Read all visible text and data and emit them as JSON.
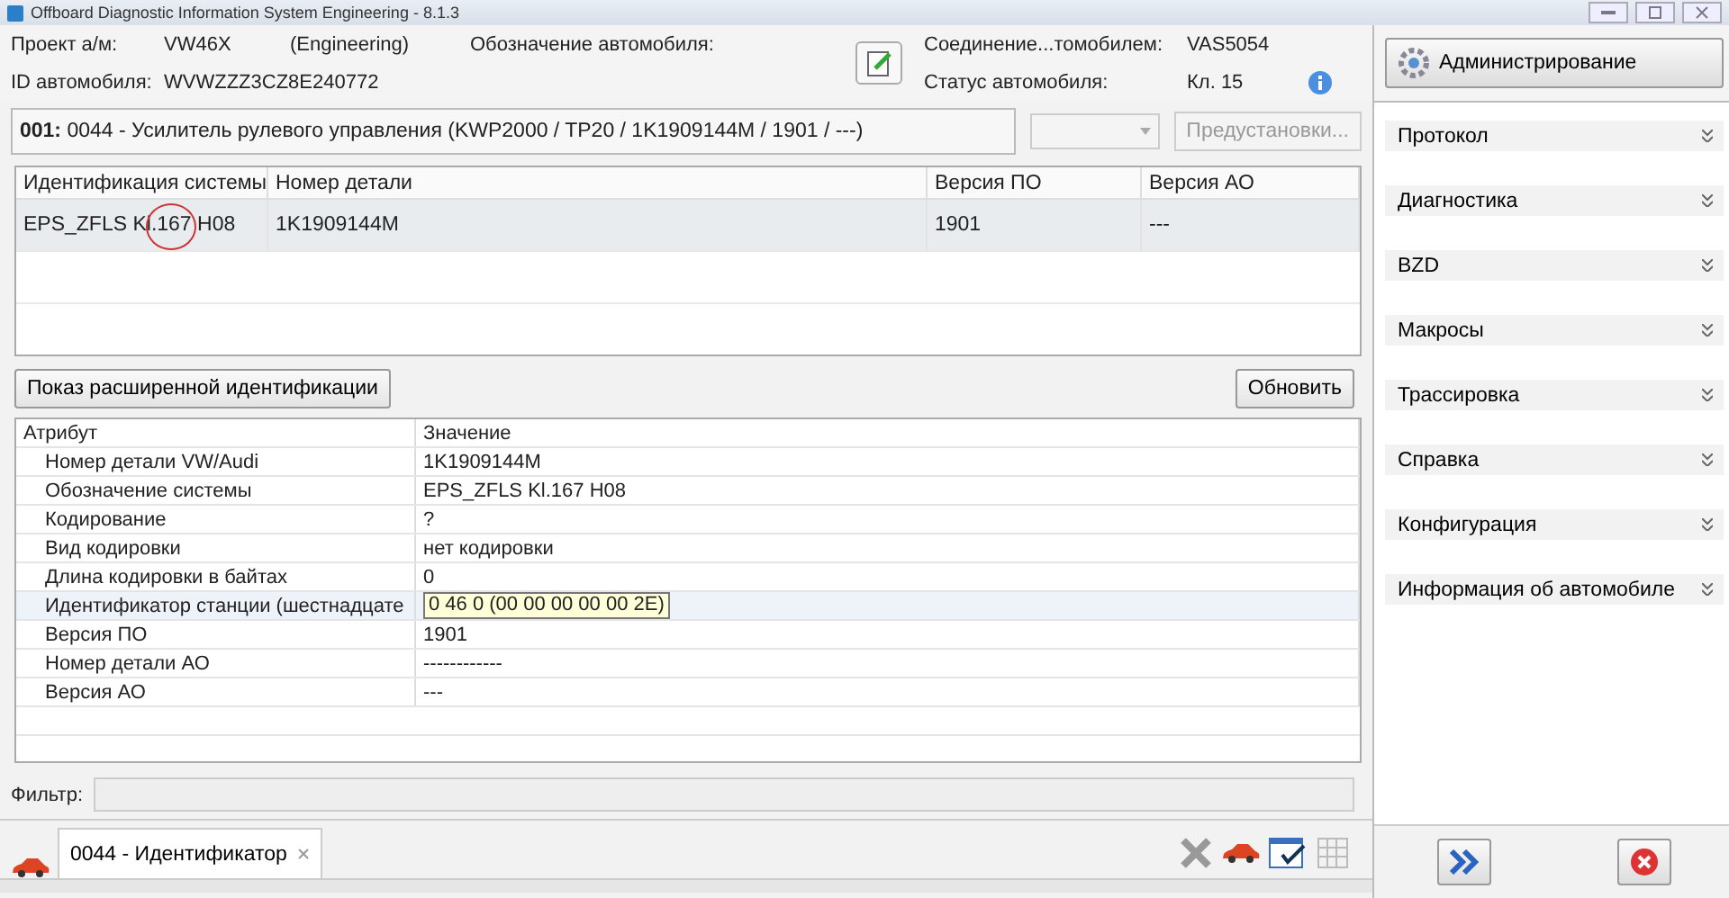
{
  "window": {
    "title": "Offboard Diagnostic Information System Engineering - 8.1.3"
  },
  "header": {
    "project_label": "Проект а/м:",
    "project": "VW46X",
    "project_mode": "(Engineering)",
    "designation_label": "Обозначение автомобиля:",
    "vin_label": "ID автомобиля:",
    "vin": "WVWZZZ3CZ8E240772",
    "connection_label": "Соединение...томобилем:",
    "connection": "VAS5054",
    "status_label": "Статус автомобиля:",
    "status": "Кл. 15"
  },
  "module": {
    "number": "001:",
    "text": "0044 - Усилитель рулевого управления  (KWP2000 / TP20 / 1K1909144M / 1901 / ---)",
    "preset_button": "Предустановки..."
  },
  "system_table": {
    "columns": [
      "Идентификация системы",
      "Номер детали",
      "Версия ПО",
      "Версия АО"
    ],
    "rows": [
      [
        "EPS_ZFLS Kl.167 H08",
        "1K1909144M",
        "1901",
        "---"
      ]
    ]
  },
  "extended_button": "Показ расширенной идентификации",
  "refresh_button": "Обновить",
  "attributes": {
    "columns": [
      "Атрибут",
      "Значение"
    ],
    "rows": [
      {
        "attribute": "Номер детали VW/Audi",
        "value": "1K1909144M",
        "highlighted": false
      },
      {
        "attribute": "Обозначение системы",
        "value": "EPS_ZFLS Kl.167 H08",
        "highlighted": false
      },
      {
        "attribute": "Кодирование",
        "value": "?",
        "highlighted": false
      },
      {
        "attribute": "Вид кодировки",
        "value": "нет кодировки",
        "highlighted": false
      },
      {
        "attribute": "Длина кодировки в байтах",
        "value": "0",
        "highlighted": false
      },
      {
        "attribute": "Идентификатор станции (шестнадцате",
        "value": "0 46 0 (00 00 00 00 00 2E)",
        "highlighted": true
      },
      {
        "attribute": "Версия ПО",
        "value": "1901",
        "highlighted": false
      },
      {
        "attribute": "Номер детали АО",
        "value": "------------",
        "highlighted": false
      },
      {
        "attribute": "Версия АО",
        "value": "---",
        "highlighted": false
      }
    ]
  },
  "filter": {
    "label": "Фильтр:"
  },
  "tabs": [
    {
      "label": "0044 - Идентификатор",
      "selected": true
    }
  ],
  "sidebar": {
    "admin_button": "Администрирование",
    "items": [
      {
        "label": "Протокол"
      },
      {
        "label": "Диагностика"
      },
      {
        "label": "BZD"
      },
      {
        "label": "Макросы"
      },
      {
        "label": "Трассировка"
      },
      {
        "label": "Справка"
      },
      {
        "label": "Конфигурация"
      },
      {
        "label": "Информация об автомобиле"
      }
    ]
  }
}
